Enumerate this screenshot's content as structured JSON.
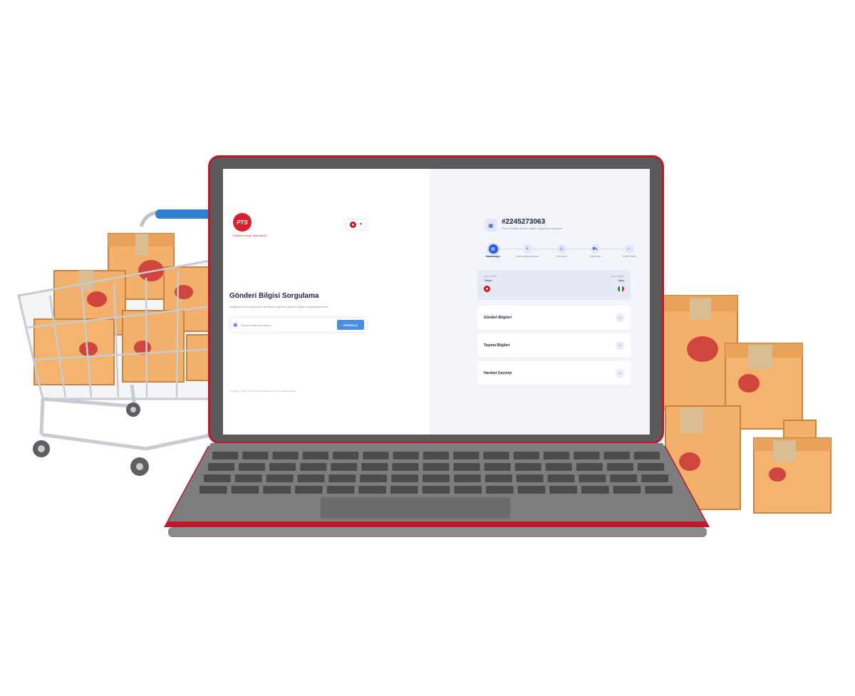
{
  "brand": {
    "logo_text": "PTS",
    "tagline": "Express Kargo Taşımacılık",
    "accent": "#d71f2e"
  },
  "language": {
    "selected": "TR",
    "icon": "turkey-flag-icon"
  },
  "query_form": {
    "title": "Gönderi Bilgisi Sorgulama",
    "description": "Aşağıdaki kutucuğa paket numaranızı girerek gönderi bilgisi sorgulayabilirsiniz.",
    "input_placeholder": "Gönderi takip Numarası...",
    "button_label": "SORGULA",
    "button_color": "#4a90e2"
  },
  "footer": {
    "copyright": "Copyright © 2008 - 2021 PTS Worldwide Express Tüm Hakları saklıdır."
  },
  "tracking": {
    "number": "#2245273063",
    "subtitle": "Paket numarası gönderi bilgileri aşağıda yer almaktadır.",
    "steps": [
      {
        "label": "Hazırlanıyor",
        "icon": "box-icon",
        "active": true
      },
      {
        "label": "Taşıma Aşamasında",
        "icon": "plane-icon",
        "active": false
      },
      {
        "label": "Gümrükte",
        "icon": "customs-icon",
        "active": false
      },
      {
        "label": "Dağıtımda",
        "icon": "truck-icon",
        "active": false
      },
      {
        "label": "Teslim Edildi",
        "icon": "check-icon",
        "active": false
      }
    ],
    "origin_label": "Çıkış Ülkesi",
    "origin_country": "Türkiye",
    "destination_label": "Varış Ülkesi",
    "destination_country": "İtalya",
    "sections": [
      {
        "title": "Gönderi Bilgileri"
      },
      {
        "title": "Taşıma Bilgileri"
      },
      {
        "title": "Hareket Geçmişi"
      }
    ]
  }
}
